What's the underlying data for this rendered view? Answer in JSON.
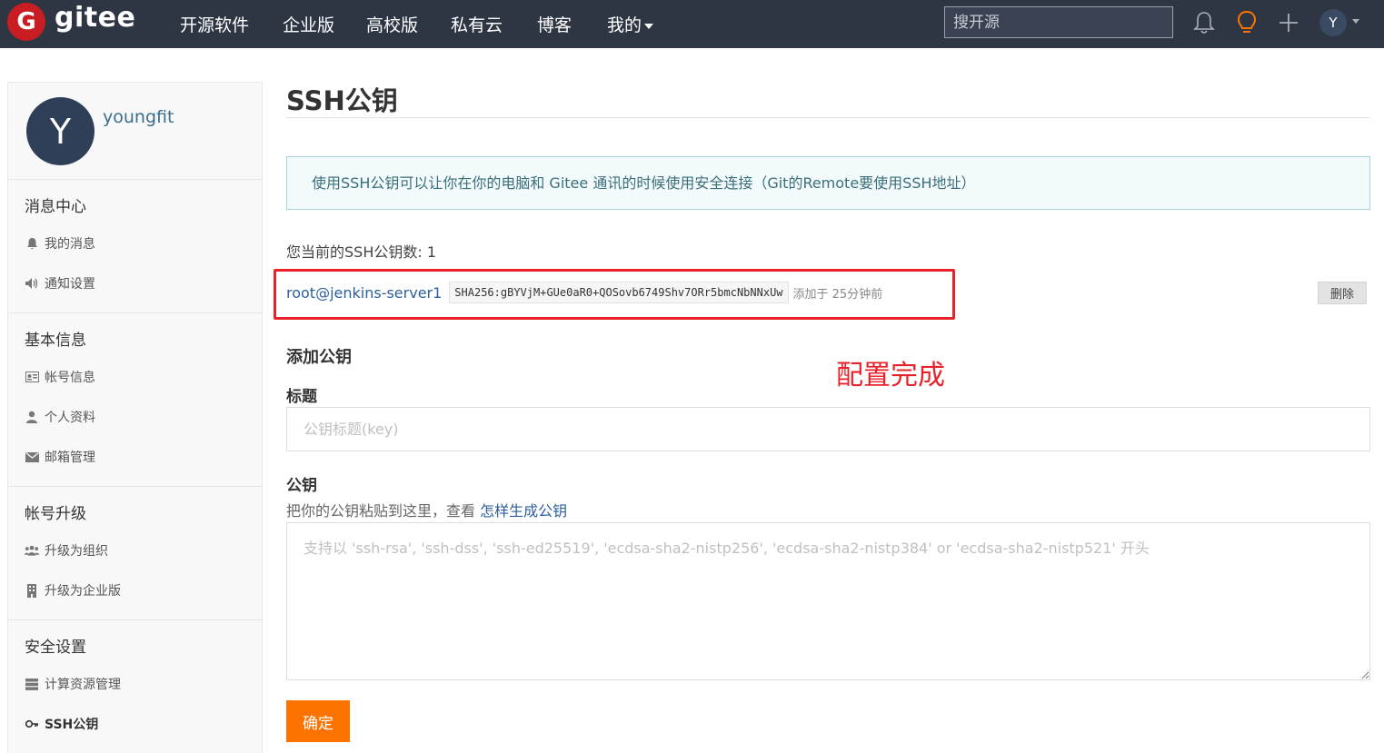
{
  "brand": {
    "logo_letter": "G",
    "name": "gitee",
    "color": "#c71d23"
  },
  "nav": {
    "items": [
      {
        "label": "开源软件"
      },
      {
        "label": "企业版"
      },
      {
        "label": "高校版"
      },
      {
        "label": "私有云"
      },
      {
        "label": "博客"
      },
      {
        "label": "我的"
      }
    ],
    "search_placeholder": "搜开源",
    "avatar_letter": "Y"
  },
  "sidebar": {
    "avatar_letter": "Y",
    "username": "youngfit",
    "sections": [
      {
        "title": "消息中心",
        "items": [
          {
            "label": "我的消息",
            "icon": "bell-icon"
          },
          {
            "label": "通知设置",
            "icon": "volume-icon"
          }
        ]
      },
      {
        "title": "基本信息",
        "items": [
          {
            "label": "帐号信息",
            "icon": "id-card-icon"
          },
          {
            "label": "个人资料",
            "icon": "user-icon"
          },
          {
            "label": "邮箱管理",
            "icon": "envelope-icon"
          }
        ]
      },
      {
        "title": "帐号升级",
        "items": [
          {
            "label": "升级为组织",
            "icon": "group-icon"
          },
          {
            "label": "升级为企业版",
            "icon": "building-icon"
          }
        ]
      },
      {
        "title": "安全设置",
        "items": [
          {
            "label": "计算资源管理",
            "icon": "server-icon"
          },
          {
            "label": "SSH公钥",
            "icon": "key-icon"
          }
        ]
      }
    ]
  },
  "main": {
    "title": "SSH公钥",
    "info": "使用SSH公钥可以让你在你的电脑和 Gitee 通讯的时候使用安全连接（Git的Remote要使用SSH地址）",
    "key_count": "您当前的SSH公钥数: 1",
    "key": {
      "title": "root@jenkins-server1",
      "fingerprint": "SHA256:gBYVjM+GUe0aR0+QOSovb6749Shv7ORr5bmcNbNNxUw",
      "added": "添加于 25分钟前",
      "delete_label": "删除"
    },
    "annotation": "配置完成",
    "add_title": "添加公钥",
    "field_title_label": "标题",
    "field_title_placeholder": "公钥标题(key)",
    "field_key_label": "公钥",
    "field_key_hint": "把你的公钥粘贴到这里，查看",
    "field_key_hint_link": "怎样生成公钥",
    "field_key_placeholder": "支持以 'ssh-rsa', 'ssh-dss', 'ssh-ed25519', 'ecdsa-sha2-nistp256', 'ecdsa-sha2-nistp384' or 'ecdsa-sha2-nistp521' 开头",
    "submit_label": "确定",
    "accent_color": "#fe7300",
    "highlight_color": "#e8222b"
  }
}
